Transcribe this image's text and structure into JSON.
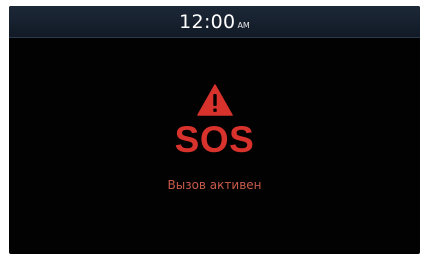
{
  "status_bar": {
    "time": "12:00",
    "ampm": "AM"
  },
  "sos": {
    "icon": "warning-triangle-icon",
    "title": "SOS",
    "status": "Вызов активен"
  },
  "colors": {
    "background": "#020202",
    "status_bar": "#1d2838",
    "alert_red": "#d8322d",
    "status_text": "#c85a4a"
  }
}
